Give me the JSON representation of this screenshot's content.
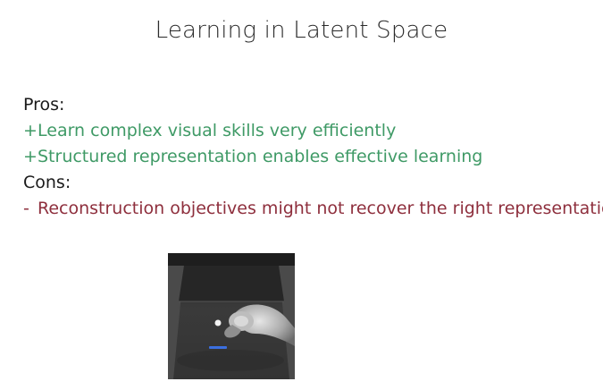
{
  "slide": {
    "title": "Learning in Latent Space",
    "pros_heading": "Pros:",
    "pros": [
      {
        "prefix": "+",
        "text": "Learn complex visual skills very efficiently"
      },
      {
        "prefix": "+",
        "text": "Structured representation enables effective learning"
      }
    ],
    "cons_heading": "Cons:",
    "cons": [
      {
        "prefix": "-",
        "text": "Reconstruction objectives might not recover the right representation"
      }
    ]
  },
  "colors": {
    "pros_text": "#3f9a66",
    "cons_text": "#8e2f3d",
    "heading_text": "#1a1a1a"
  },
  "media": {
    "icon": "robot-video-frame"
  }
}
